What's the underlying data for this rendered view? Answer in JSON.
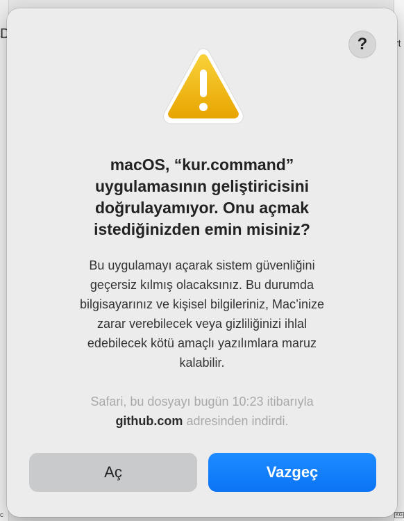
{
  "background": {
    "left_fragment": "De",
    "right_fragment": "rt",
    "left_tag": "C",
    "right_tag": "KG"
  },
  "dialog": {
    "help_label": "?",
    "title_lines": [
      "macOS, “kur.command”",
      "uygulamasının geliştiricisini",
      "doğrulayamıyor. Onu açmak",
      "istediğinizden emin misiniz?"
    ],
    "body_lines": [
      "Bu uygulamayı açarak sistem güvenliğini",
      "geçersiz kılmış olacaksınız. Bu durumda",
      "bilgisayarınız ve kişisel bilgileriniz, Mac’inize",
      "zarar verebilecek veya gizliliğinizi ihlal",
      "edebilecek kötü amaçlı yazılımlara maruz",
      "kalabilir."
    ],
    "source": {
      "line1": "Safari, bu dosyayı bugün 10:23 itibarıyla",
      "domain": "github.com",
      "line2_rest": " adresinden indirdi."
    },
    "buttons": {
      "open": "Aç",
      "cancel": "Vazgeç"
    },
    "colors": {
      "accent": "#0a74f5",
      "warning": "#f3b80c"
    },
    "icon": "warning-icon"
  }
}
